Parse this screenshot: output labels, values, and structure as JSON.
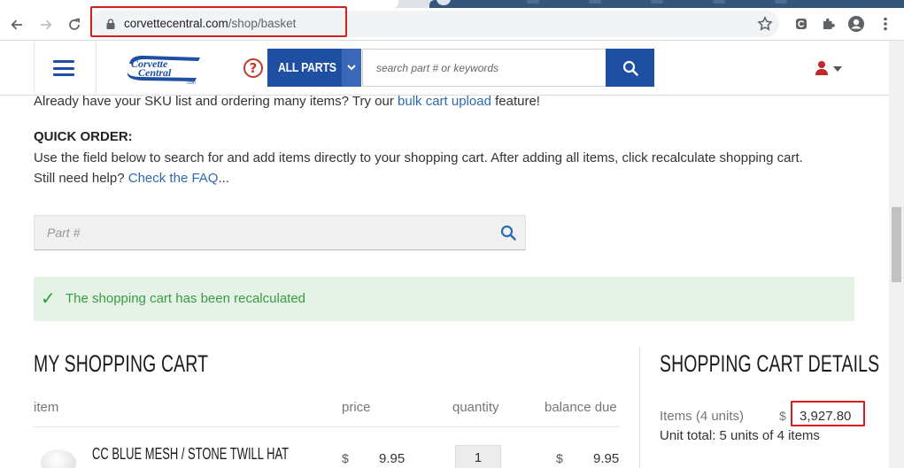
{
  "browser": {
    "url_domain": "corvettecentral.com",
    "url_path": "/shop/basket"
  },
  "header": {
    "logo_text": "Corvette Central",
    "logo_sub": ".com",
    "all_parts_label": "ALL PARTS",
    "search_placeholder": "search part # or keywords"
  },
  "intro": {
    "line_before": "Already have your SKU list and ordering many items? Try our ",
    "bulk_link": "bulk cart upload",
    "line_after": " feature!"
  },
  "quick_order": {
    "title": "QUICK ORDER:",
    "line1": "Use the field below to search for and add items directly to your shopping cart. After adding all items, click recalculate shopping cart.",
    "line2_before": "Still need help? ",
    "faq_link": "Check the FAQ",
    "line2_after": "...",
    "part_placeholder": "Part #"
  },
  "notice": {
    "message": "The shopping cart has been recalculated",
    "color": "#3a9a43"
  },
  "cart": {
    "title": "MY SHOPPING CART",
    "columns": {
      "item": "item",
      "price": "price",
      "quantity": "quantity",
      "balance": "balance due"
    },
    "items": [
      {
        "name": "CC BLUE MESH / STONE TWILL HAT",
        "currency": "$",
        "price": "9.95",
        "quantity": "1",
        "balance_currency": "$",
        "balance": "9.95"
      }
    ]
  },
  "details": {
    "title": "SHOPPING CART DETAILS",
    "items_label": "Items (4 units)",
    "currency": "$",
    "items_value": "3,927.80",
    "unit_total": "Unit total: 5 units of 4 items"
  },
  "colors": {
    "brand_blue": "#1f4fa3",
    "highlight_red": "#d81e1e",
    "link_blue": "#2b6cb0"
  }
}
